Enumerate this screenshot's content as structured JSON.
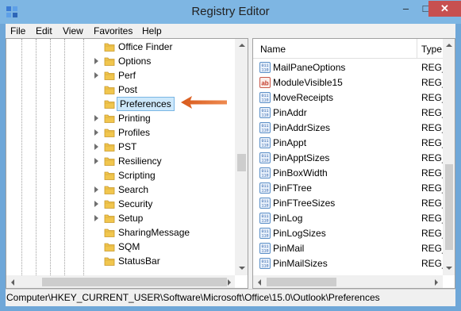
{
  "window": {
    "title": "Registry Editor",
    "minimize": "–",
    "maximize": "□",
    "close": "✕"
  },
  "menu": [
    "File",
    "Edit",
    "View",
    "Favorites",
    "Help"
  ],
  "tree": {
    "selected": "Preferences",
    "items": [
      {
        "label": "Office Finder",
        "expandable": false
      },
      {
        "label": "Options",
        "expandable": true
      },
      {
        "label": "Perf",
        "expandable": true
      },
      {
        "label": "Post",
        "expandable": false
      },
      {
        "label": "Preferences",
        "expandable": false
      },
      {
        "label": "Printing",
        "expandable": true
      },
      {
        "label": "Profiles",
        "expandable": true
      },
      {
        "label": "PST",
        "expandable": true
      },
      {
        "label": "Resiliency",
        "expandable": true
      },
      {
        "label": "Scripting",
        "expandable": false
      },
      {
        "label": "Search",
        "expandable": true
      },
      {
        "label": "Security",
        "expandable": true
      },
      {
        "label": "Setup",
        "expandable": true
      },
      {
        "label": "SharingMessage",
        "expandable": false
      },
      {
        "label": "SQM",
        "expandable": false
      },
      {
        "label": "StatusBar",
        "expandable": false
      }
    ]
  },
  "values": {
    "columns": {
      "name": "Name",
      "type": "Type"
    },
    "rows": [
      {
        "name": "MailPaneOptions",
        "type": "REG_",
        "icon": "binary-value-icon"
      },
      {
        "name": "ModuleVisible15",
        "type": "REG_",
        "icon": "string-value-icon"
      },
      {
        "name": "MoveReceipts",
        "type": "REG_",
        "icon": "binary-value-icon"
      },
      {
        "name": "PinAddr",
        "type": "REG_",
        "icon": "binary-value-icon"
      },
      {
        "name": "PinAddrSizes",
        "type": "REG_",
        "icon": "binary-value-icon"
      },
      {
        "name": "PinAppt",
        "type": "REG_",
        "icon": "binary-value-icon"
      },
      {
        "name": "PinApptSizes",
        "type": "REG_",
        "icon": "binary-value-icon"
      },
      {
        "name": "PinBoxWidth",
        "type": "REG_",
        "icon": "binary-value-icon"
      },
      {
        "name": "PinFTree",
        "type": "REG_",
        "icon": "binary-value-icon"
      },
      {
        "name": "PinFTreeSizes",
        "type": "REG_",
        "icon": "binary-value-icon"
      },
      {
        "name": "PinLog",
        "type": "REG_",
        "icon": "binary-value-icon"
      },
      {
        "name": "PinLogSizes",
        "type": "REG_",
        "icon": "binary-value-icon"
      },
      {
        "name": "PinMail",
        "type": "REG_",
        "icon": "binary-value-icon"
      },
      {
        "name": "PinMailSizes",
        "type": "REG_",
        "icon": "binary-value-icon"
      }
    ]
  },
  "status": {
    "path": "Computer\\HKEY_CURRENT_USER\\Software\\Microsoft\\Office\\15.0\\Outlook\\Preferences"
  },
  "colors": {
    "accent_arrow": "#e2692b",
    "selection": "#cde8fb",
    "titlebar": "#7eb6e3",
    "close": "#c75050"
  }
}
